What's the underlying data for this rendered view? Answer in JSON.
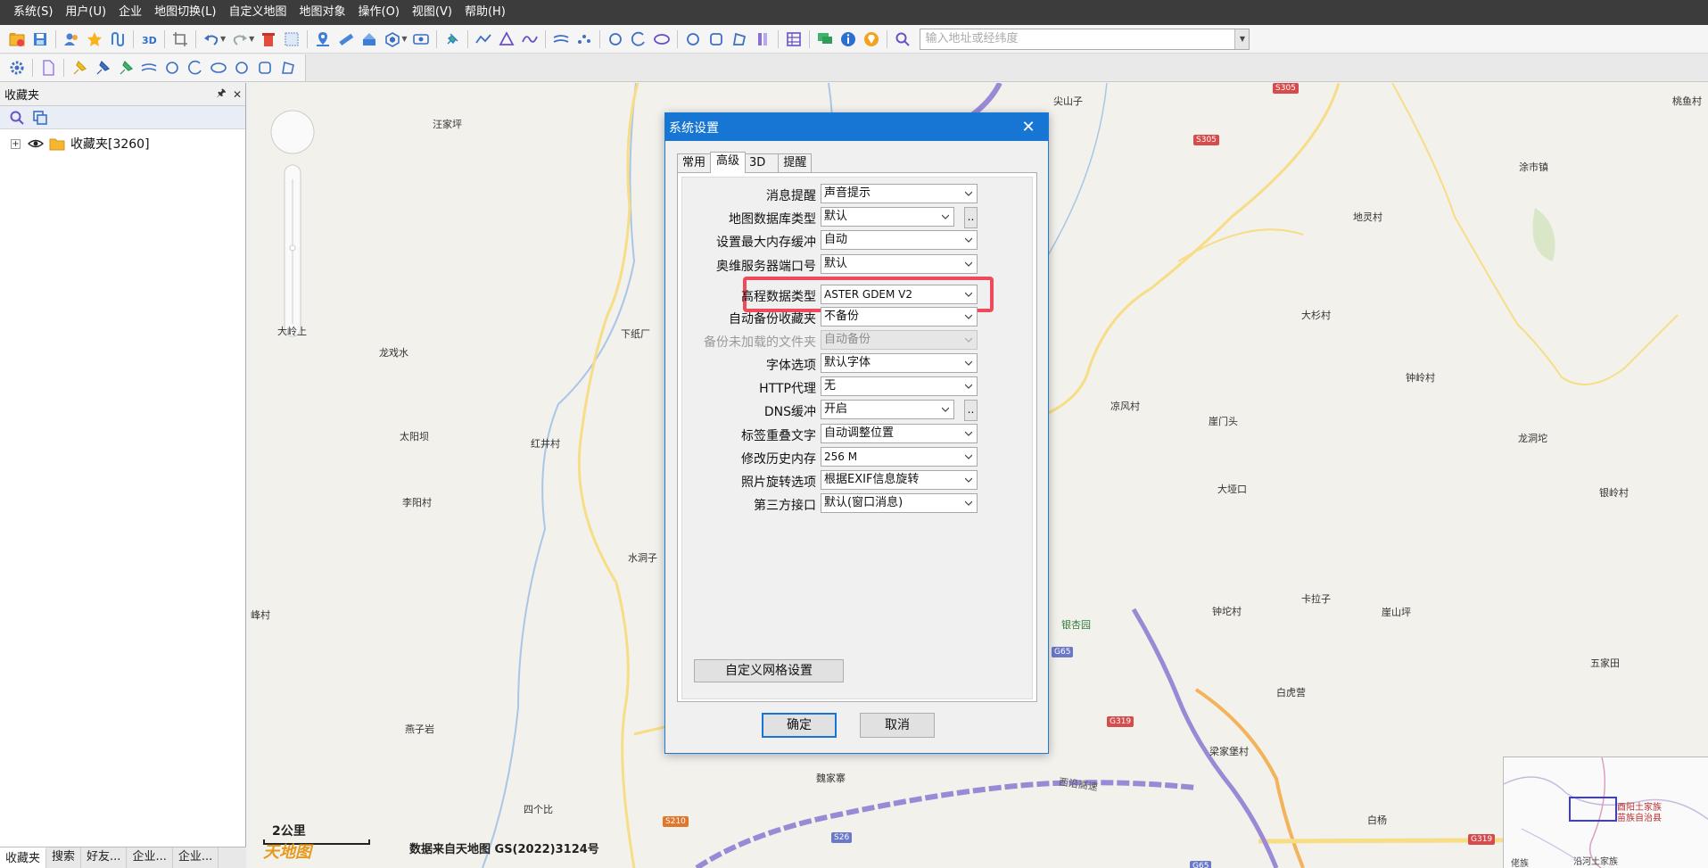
{
  "menu": [
    "系统(S)",
    "用户(U)",
    "企业",
    "地图切换(L)",
    "自定义地图",
    "地图对象",
    "操作(O)",
    "视图(V)",
    "帮助(H)"
  ],
  "search": {
    "placeholder": "输入地址或经纬度"
  },
  "panel": {
    "title": "收藏夹",
    "pin_glyph": "🖈",
    "close_glyph": "✕",
    "tree_root": "收藏夹[3260]",
    "expander": "+"
  },
  "bottom_tabs": [
    "收藏夹",
    "搜索",
    "好友...",
    "企业...",
    "企业..."
  ],
  "map": {
    "places": [
      "尖山子",
      "桃鱼村",
      "汪家坪",
      "涂市镇",
      "地灵村",
      "大岭上",
      "下纸厂",
      "大杉村",
      "龙戏水",
      "钟岭村",
      "凉风村",
      "崖门头",
      "太阳坝",
      "红井村",
      "龙洞坨",
      "李阳村",
      "大垭口",
      "银岭村",
      "水洞子",
      "峰村",
      "银杏园",
      "钟坨村",
      "卡拉子",
      "崖山坪",
      "五家田",
      "白虎营",
      "燕子岩",
      "梁家堡村",
      "魏家寨",
      "四个比",
      "白杨",
      "佬族",
      "沿河土家族"
    ],
    "road_labels": {
      "s305a": "S305",
      "s305b": "S305",
      "g65a": "G65",
      "g319a": "G319",
      "g319b": "G319",
      "s210": "S210",
      "s26": "S26",
      "g65b": "G65",
      "expressway": "西沿高速"
    },
    "scale_label": "2公里",
    "logo": "天地图",
    "credit": "数据来自天地图  GS(2022)3124号",
    "overview_label1": "酉阳土家族",
    "overview_label2": "苗族自治县"
  },
  "dialog": {
    "title": "系统设置",
    "close_glyph": "✕",
    "tabs": [
      "常用",
      "高级",
      "3D",
      "提醒"
    ],
    "active_tab": "高级",
    "rows": [
      {
        "label": "消息提醒",
        "value": "声音提示"
      },
      {
        "label": "地图数据库类型",
        "value": "默认",
        "button": ".."
      },
      {
        "label": "设置最大内存缓冲",
        "value": "自动"
      },
      {
        "label": "奥维服务器端口号",
        "value": "默认"
      },
      {
        "label": "高程数据类型",
        "value": "ASTER GDEM V2"
      },
      {
        "label": "自动备份收藏夹",
        "value": "不备份"
      },
      {
        "label": "备份未加载的文件夹",
        "value": "自动备份",
        "disabled": true
      },
      {
        "label": "字体选项",
        "value": "默认字体"
      },
      {
        "label": "HTTP代理",
        "value": "无"
      },
      {
        "label": "DNS缓冲",
        "value": "开启",
        "button": ".."
      },
      {
        "label": "标签重叠文字",
        "value": "自动调整位置"
      },
      {
        "label": "修改历史内存",
        "value": "256 M"
      },
      {
        "label": "照片旋转选项",
        "value": "根据EXIF信息旋转"
      },
      {
        "label": "第三方接口",
        "value": "默认(窗口消息)"
      }
    ],
    "grid_button": "自定义网格设置",
    "ok": "确定",
    "cancel": "取消"
  },
  "colors": {
    "dialog_titlebar": "#1776d3",
    "highlight": "#f04a5a",
    "menubar": "#3c3c3c",
    "map_bg": "#f3f1ec",
    "road_yellow": "#f6dd86",
    "road_purple": "#9a8ad6"
  }
}
